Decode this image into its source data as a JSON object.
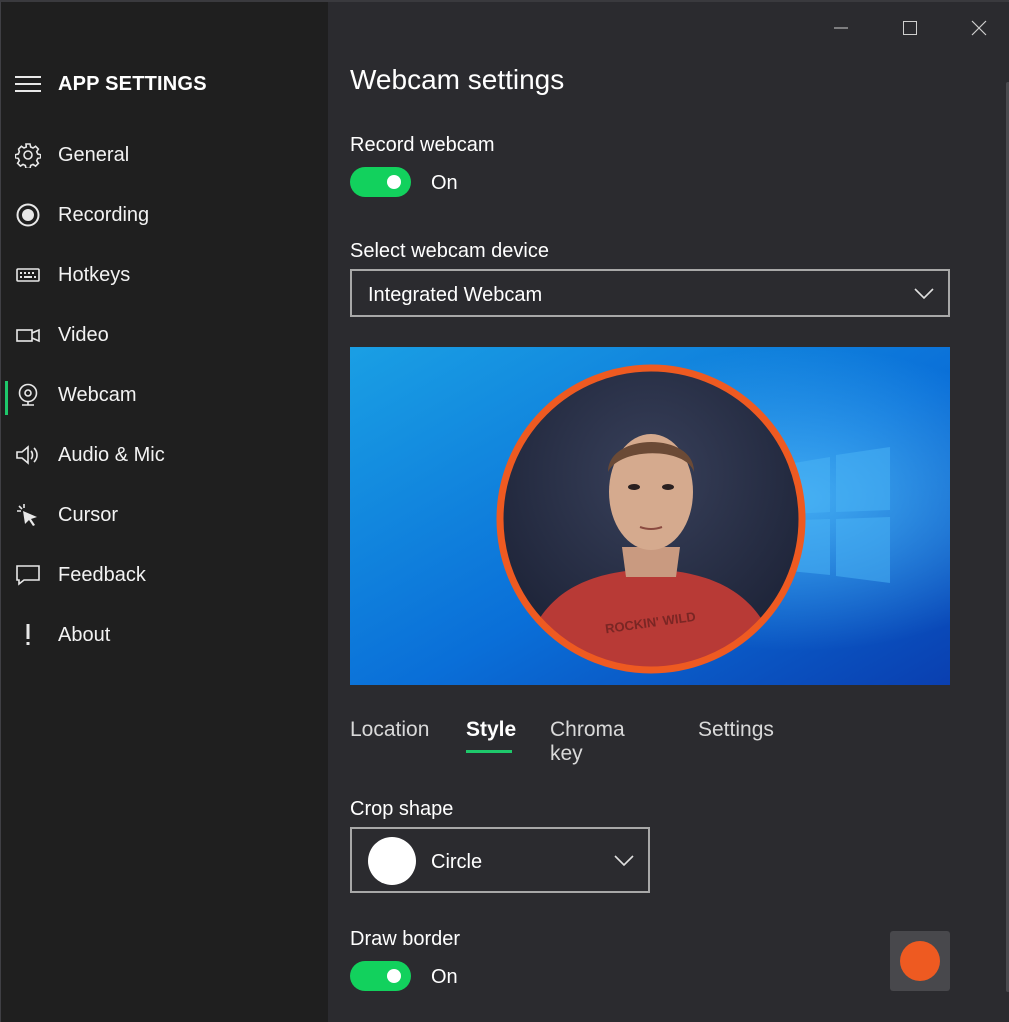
{
  "sidebar": {
    "title": "APP SETTINGS",
    "items": [
      {
        "label": "General",
        "icon": "gear-icon"
      },
      {
        "label": "Recording",
        "icon": "record-icon"
      },
      {
        "label": "Hotkeys",
        "icon": "keyboard-icon"
      },
      {
        "label": "Video",
        "icon": "video-camera-icon"
      },
      {
        "label": "Webcam",
        "icon": "webcam-icon",
        "active": true
      },
      {
        "label": "Audio & Mic",
        "icon": "speaker-icon"
      },
      {
        "label": "Cursor",
        "icon": "cursor-icon"
      },
      {
        "label": "Feedback",
        "icon": "speech-bubble-icon"
      },
      {
        "label": "About",
        "icon": "exclamation-icon"
      }
    ]
  },
  "window_controls": [
    "minimize-icon",
    "maximize-icon",
    "close-icon"
  ],
  "main": {
    "title": "Webcam settings",
    "record_webcam": {
      "label": "Record webcam",
      "state": "On",
      "enabled": true
    },
    "device": {
      "label": "Select webcam device",
      "value": "Integrated Webcam"
    },
    "tabs": [
      {
        "label": "Location"
      },
      {
        "label": "Style",
        "active": true
      },
      {
        "label": "Chroma key"
      },
      {
        "label": "Settings"
      }
    ],
    "crop_shape": {
      "label": "Crop shape",
      "value": "Circle"
    },
    "draw_border": {
      "label": "Draw border",
      "state": "On",
      "enabled": true,
      "color": "#ee5a21"
    }
  },
  "colors": {
    "accent_green": "#12d15d",
    "border_orange": "#ee5a21",
    "sidebar_bg": "#1f1f1f",
    "main_bg": "#2b2b2f"
  }
}
